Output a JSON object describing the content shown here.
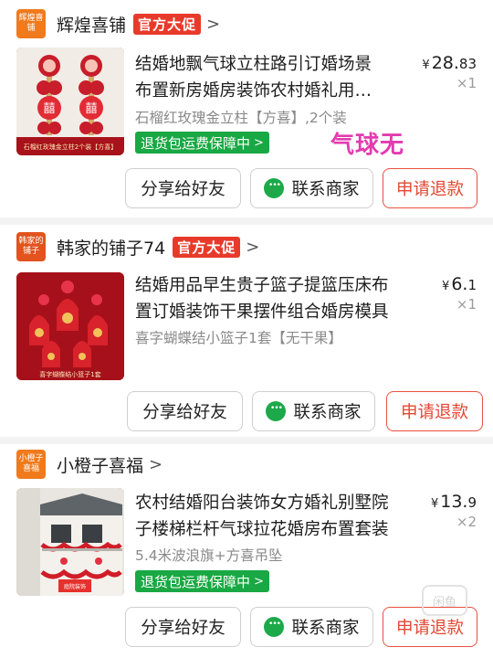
{
  "orders": [
    {
      "shop_logo": "辉煌喜铺",
      "shop_name": "辉煌喜铺",
      "badge": "官方大促",
      "thumb_caption": "石榴红玫瑰金立柱2个装【方喜】",
      "title_line1": "结婚地飘气球立柱路引订婚场景",
      "title_line2": "布置新房婚房装饰农村婚礼用…",
      "spec": "石榴红玫瑰金立柱【方喜】,2个装",
      "guarantee": "退货包运费保障中",
      "price_yen": "¥",
      "price_int": "28.",
      "price_dec": "83",
      "qty": "×1"
    },
    {
      "shop_logo": "韩家的铺子",
      "shop_name": "韩家的铺子74",
      "badge": "官方大促",
      "thumb_caption": "喜字蝴蝶结小篮子1套",
      "title_line1": "结婚用品早生贵子篮子提篮压床布",
      "title_line2": "置订婚装饰干果摆件组合婚房模具",
      "spec": "喜字蝴蝶结小篮子1套【无干果】",
      "guarantee": "",
      "price_yen": "¥",
      "price_int": "6.",
      "price_dec": "1",
      "qty": "×1"
    },
    {
      "shop_logo": "小橙子喜福",
      "shop_name": "小橙子喜福",
      "badge": "",
      "thumb_caption": "庭院装饰",
      "title_line1": "农村结婚阳台装饰女方婚礼别墅院",
      "title_line2": "子楼梯栏杆气球拉花婚房布置套装",
      "spec": "5.4米波浪旗+方喜吊坠",
      "guarantee": "退货包运费保障中",
      "price_yen": "¥",
      "price_int": "13.",
      "price_dec": "9",
      "qty": "×2"
    }
  ],
  "buttons": {
    "share": "分享给好友",
    "contact": "联系商家",
    "refund": "申请退款"
  },
  "chevron": ">",
  "handwritten_note": "气球无",
  "watermark": "闲鱼",
  "colors": {
    "official_badge": "#e83a2a",
    "guarantee_green": "#19a843",
    "refund_red": "#e34733",
    "shop_logo_orange": "#f07a1c",
    "handwrite_pink": "#e33bb0"
  }
}
